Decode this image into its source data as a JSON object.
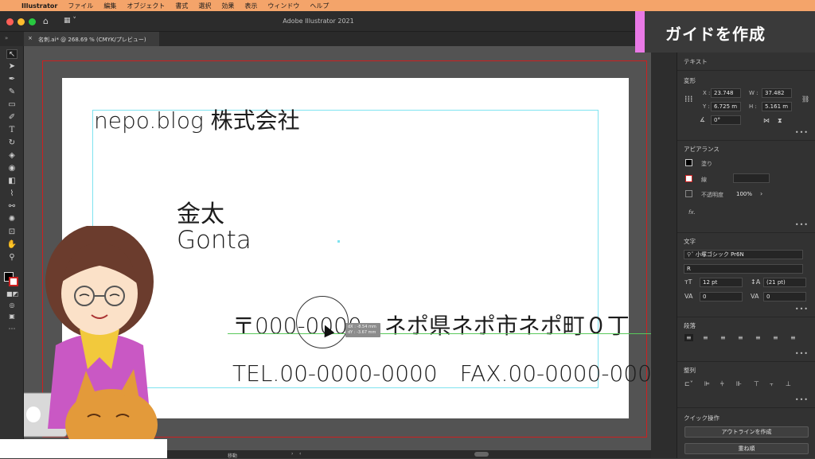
{
  "menubar": {
    "apple": "",
    "app_name": "Illustrator",
    "items": [
      "ファイル",
      "編集",
      "オブジェクト",
      "書式",
      "選択",
      "効果",
      "表示",
      "ウィンドウ",
      "ヘルプ"
    ]
  },
  "window": {
    "title": "Adobe Illustrator 2021"
  },
  "document_tab": {
    "close": "×",
    "label": "名刺.ai* @ 268.69 % (CMYK/プレビュー)"
  },
  "card": {
    "company": "nepo.blog 株式会社",
    "name_jp": "金太",
    "name_en": "Gonta",
    "address": "〒000-0000　ネポ県ネポ市ネポ町０丁",
    "phone_fax": "TEL.00-0000-0000　FAX.00-0000-000"
  },
  "tooltip": {
    "dx": "dX : -8.54 mm",
    "dy": "dY : -3.67 mm"
  },
  "bottom_bar": {
    "mode": "移動"
  },
  "banner": {
    "text": "ガイドを作成",
    "accent_color": "#e979e6"
  },
  "panel": {
    "title": "テキスト",
    "transform": {
      "header": "変形",
      "x_label": "X :",
      "x_value": "23.748",
      "y_label": "Y :",
      "y_value": "6.725 m",
      "w_label": "W :",
      "w_value": "37.482",
      "h_label": "H :",
      "h_value": "5.161 m",
      "angle": "0°"
    },
    "appearance": {
      "header": "アピアランス",
      "fill_label": "塗り",
      "stroke_label": "線",
      "opacity_label": "不透明度",
      "opacity_value": "100%",
      "fx": "fx."
    },
    "character": {
      "header": "文字",
      "font_family": "小塚ゴシック Pr6N",
      "font_style": "R",
      "size": "12 pt",
      "leading": "(21 pt)",
      "tracking": "0",
      "kerning": "0"
    },
    "paragraph": {
      "header": "段落"
    },
    "align": {
      "header": "整列"
    },
    "quick_actions": {
      "header": "クイック操作",
      "outline_button": "アウトラインを作成",
      "arrange_button": "重ね順"
    }
  },
  "colors": {
    "menubar": "#f4a46a",
    "guide": "#7fe3f0",
    "bleed": "#cc2020",
    "smart_guide": "#59c95b"
  }
}
